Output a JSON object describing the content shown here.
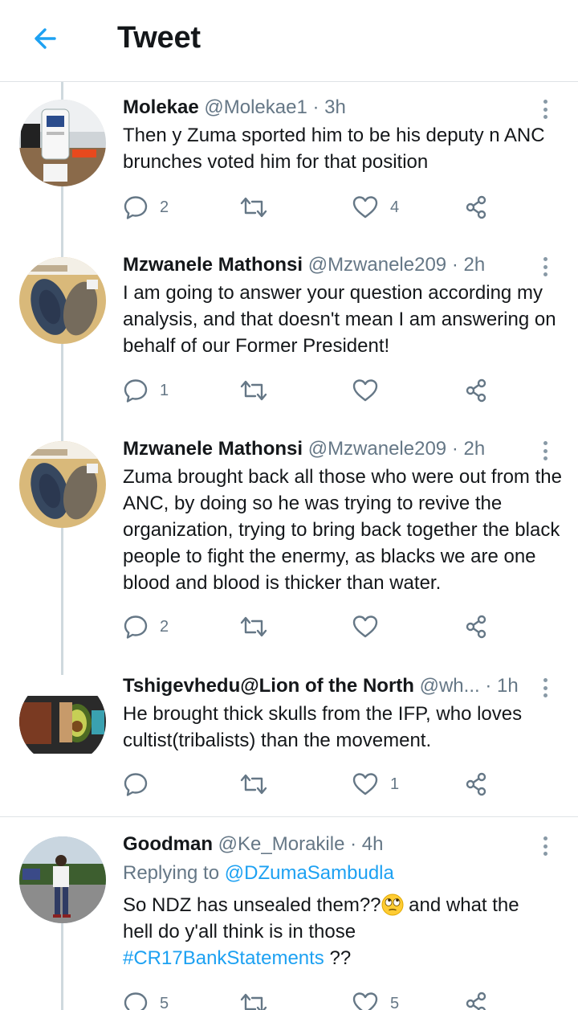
{
  "header": {
    "title": "Tweet"
  },
  "tweets": [
    {
      "name": "Molekae",
      "handle": "@Molekae1",
      "time": "· 3h",
      "text": "Then y Zuma sported him to be his deputy n ANC brunches voted him for that position",
      "replies": "2",
      "retweets": "",
      "likes": "4"
    },
    {
      "name": "Mzwanele Mathonsi",
      "handle": "@Mzwanele209",
      "time": "· 2h",
      "text": "I am going to answer your question according my analysis, and that doesn't mean I am answering on behalf of our Former President!",
      "replies": "1",
      "retweets": "",
      "likes": ""
    },
    {
      "name": "Mzwanele Mathonsi",
      "handle": "@Mzwanele209",
      "time": "· 2h",
      "text": "Zuma brought back all those who were out from the ANC, by doing so he was trying to revive the organization, trying to bring back together the black people to fight the enermy, as blacks we are one blood and blood is thicker than water.",
      "replies": "2",
      "retweets": "",
      "likes": ""
    },
    {
      "name": "Tshigevhedu@Lion of the North",
      "handle": "@wh...",
      "time": "· 1h",
      "text": "He brought thick skulls from the IFP, who loves cultist(tribalists) than the movement.",
      "replies": "",
      "retweets": "",
      "likes": "1"
    },
    {
      "name": "Goodman",
      "handle": "@Ke_Morakile",
      "time": "· 4h",
      "replying_prefix": "Replying to",
      "replying_to": "@DZumaSambudla",
      "text_part1": "So NDZ has unsealed them??",
      "text_part2": " and what the hell do y'all think is in those ",
      "hashtag": "#CR17BankStatements",
      "text_part3": " ??",
      "replies": "5",
      "retweets": "",
      "likes": "5"
    }
  ],
  "icons": {
    "back": "arrow-left-icon",
    "more": "vertical-dots-icon",
    "reply": "speech-bubble-icon",
    "retweet": "retweet-icon",
    "like": "heart-icon",
    "share": "share-icon",
    "emoji": "face-with-rolling-eyes-emoji"
  },
  "colors": {
    "accent": "#1da1f2",
    "secondary_text": "#657786",
    "icon": "#657786",
    "thread_line": "#cfd9de"
  }
}
